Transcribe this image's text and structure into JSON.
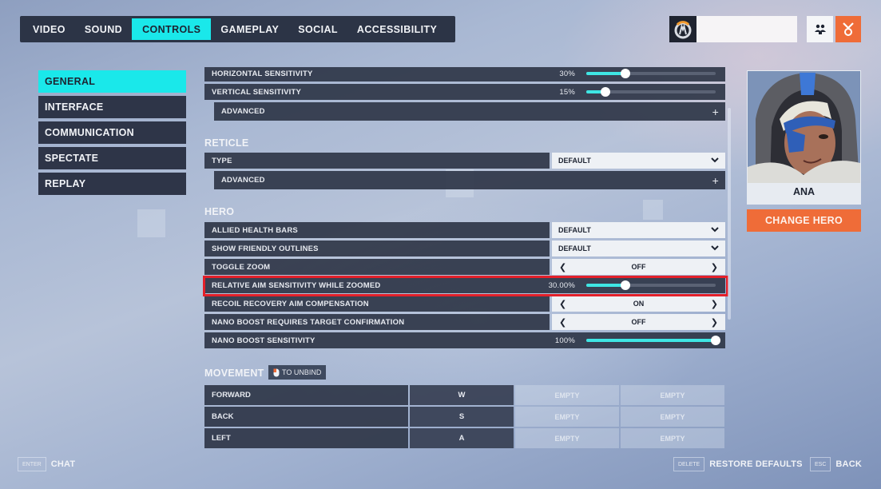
{
  "top_tabs": [
    {
      "label": "VIDEO",
      "active": false
    },
    {
      "label": "SOUND",
      "active": false
    },
    {
      "label": "CONTROLS",
      "active": true
    },
    {
      "label": "GAMEPLAY",
      "active": false
    },
    {
      "label": "SOCIAL",
      "active": false
    },
    {
      "label": "ACCESSIBILITY",
      "active": false
    }
  ],
  "header_icons": {
    "logo": "overwatch-logo-icon",
    "social": "social-group-icon",
    "rewards": "medal-icon"
  },
  "sidebar": {
    "items": [
      {
        "label": "GENERAL",
        "active": true
      },
      {
        "label": "INTERFACE",
        "active": false
      },
      {
        "label": "COMMUNICATION",
        "active": false
      },
      {
        "label": "SPECTATE",
        "active": false
      },
      {
        "label": "REPLAY",
        "active": false
      }
    ]
  },
  "settings": {
    "horizontal_sensitivity": {
      "label": "HORIZONTAL SENSITIVITY",
      "value": "30%",
      "fraction": 0.3
    },
    "vertical_sensitivity": {
      "label": "VERTICAL SENSITIVITY",
      "value": "15%",
      "fraction": 0.15
    },
    "advanced_1": {
      "label": "ADVANCED",
      "icon": "+"
    },
    "reticle": {
      "title": "RETICLE",
      "type": {
        "label": "TYPE",
        "value": "DEFAULT"
      },
      "advanced": {
        "label": "ADVANCED",
        "icon": "+"
      }
    },
    "hero": {
      "title": "HERO",
      "allied_health_bars": {
        "label": "ALLIED HEALTH BARS",
        "value": "DEFAULT"
      },
      "show_friendly_outlines": {
        "label": "SHOW FRIENDLY OUTLINES",
        "value": "DEFAULT"
      },
      "toggle_zoom": {
        "label": "TOGGLE ZOOM",
        "value": "OFF"
      },
      "relative_aim": {
        "label": "RELATIVE AIM SENSITIVITY WHILE ZOOMED",
        "value": "30.00%",
        "fraction": 0.3
      },
      "recoil_recovery": {
        "label": "RECOIL RECOVERY AIM COMPENSATION",
        "value": "ON"
      },
      "nano_confirm": {
        "label": "NANO BOOST REQUIRES TARGET CONFIRMATION",
        "value": "OFF"
      },
      "nano_sensitivity": {
        "label": "NANO BOOST SENSITIVITY",
        "value": "100%",
        "fraction": 1.0
      }
    },
    "movement": {
      "title": "MOVEMENT",
      "unbind_hint": "TO UNBIND",
      "binds": [
        {
          "action": "FORWARD",
          "key": "W",
          "alt1": "EMPTY",
          "alt2": "EMPTY"
        },
        {
          "action": "BACK",
          "key": "S",
          "alt1": "EMPTY",
          "alt2": "EMPTY"
        },
        {
          "action": "LEFT",
          "key": "A",
          "alt1": "EMPTY",
          "alt2": "EMPTY"
        }
      ]
    }
  },
  "arrows": {
    "left": "❮",
    "right": "❯",
    "chevron": "❯"
  },
  "hero_panel": {
    "name": "ANA",
    "change_button": "CHANGE HERO"
  },
  "footer": {
    "chat": {
      "key": "ENTER",
      "label": "CHAT"
    },
    "restore": {
      "key": "DELETE",
      "label": "RESTORE DEFAULTS"
    },
    "back": {
      "key": "ESC",
      "label": "BACK"
    }
  },
  "colors": {
    "accent": "#1ae8ea",
    "orange": "#ef6c38",
    "highlight": "#e3202a",
    "panel": "#2e3548"
  }
}
